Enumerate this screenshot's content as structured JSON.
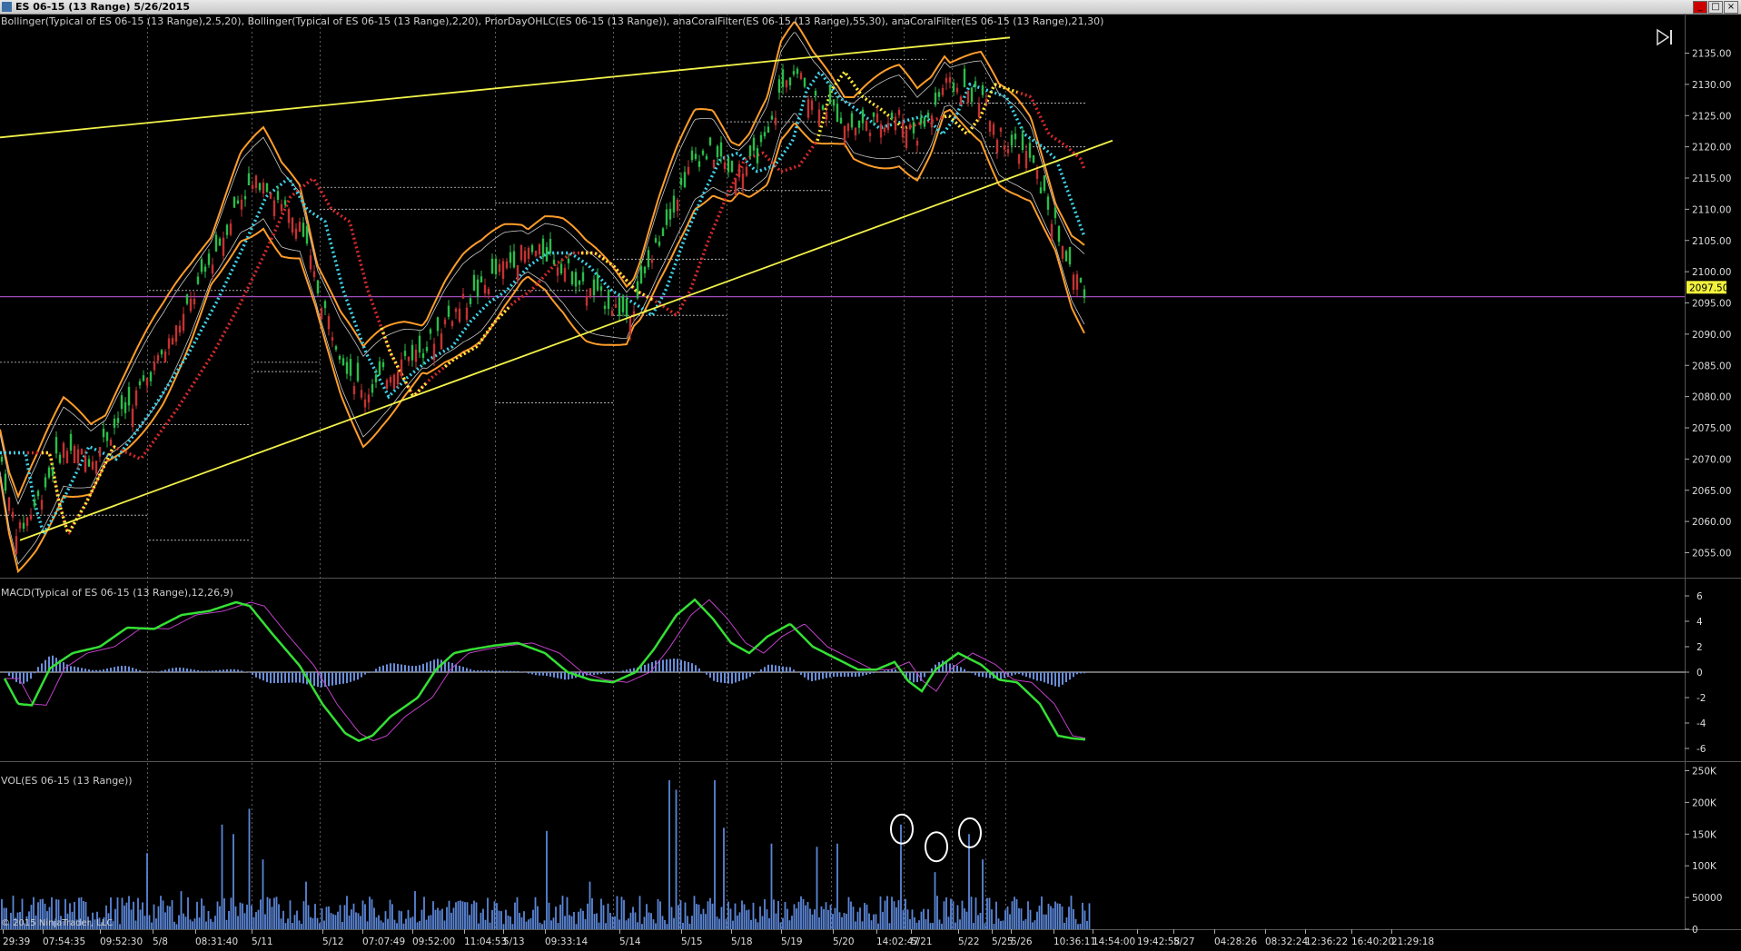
{
  "window": {
    "title": "ES 06-15 (13 Range)  5/26/2015",
    "buttons": [
      "_",
      "□",
      "×"
    ]
  },
  "copyright": "© 2015 NinjaTrader, LLC",
  "chart_data": [
    {
      "type": "candlestick",
      "title": "Bollinger(Typical of ES 06-15 (13 Range),2.5,20), Bollinger(Typical of ES 06-15 (13 Range),2,20), PriorDayOHLC(ES 06-15 (13 Range)), anaCoralFilter(ES 06-15 (13 Range),55,30), anaCoralFilter(ES 06-15 (13 Range),21,30)",
      "ylim": [
        2051,
        2139
      ],
      "yticks": [
        2055,
        2060,
        2065,
        2070,
        2075,
        2080,
        2085,
        2090,
        2095,
        2100,
        2105,
        2110,
        2115,
        2120,
        2125,
        2130,
        2135
      ],
      "last_price": "2097.50",
      "price_path": [
        [
          0,
          2071
        ],
        [
          10,
          2063
        ],
        [
          20,
          2058
        ],
        [
          40,
          2063
        ],
        [
          70,
          2072
        ],
        [
          100,
          2070
        ],
        [
          140,
          2078
        ],
        [
          180,
          2087
        ],
        [
          210,
          2095
        ],
        [
          240,
          2104
        ],
        [
          265,
          2112
        ],
        [
          290,
          2115
        ],
        [
          310,
          2110
        ],
        [
          330,
          2108
        ],
        [
          350,
          2097
        ],
        [
          375,
          2087
        ],
        [
          400,
          2080
        ],
        [
          420,
          2083
        ],
        [
          445,
          2086
        ],
        [
          470,
          2088
        ],
        [
          490,
          2092
        ],
        [
          510,
          2095
        ],
        [
          530,
          2097
        ],
        [
          555,
          2101
        ],
        [
          575,
          2103
        ],
        [
          600,
          2103
        ],
        [
          620,
          2101
        ],
        [
          645,
          2097
        ],
        [
          670,
          2095
        ],
        [
          690,
          2093
        ],
        [
          705,
          2097
        ],
        [
          725,
          2105
        ],
        [
          745,
          2112
        ],
        [
          765,
          2118
        ],
        [
          785,
          2119
        ],
        [
          805,
          2116
        ],
        [
          825,
          2117
        ],
        [
          845,
          2121
        ],
        [
          860,
          2129
        ],
        [
          875,
          2132
        ],
        [
          895,
          2128
        ],
        [
          915,
          2126
        ],
        [
          940,
          2123
        ],
        [
          965,
          2124
        ],
        [
          990,
          2125
        ],
        [
          1010,
          2122
        ],
        [
          1025,
          2125
        ],
        [
          1040,
          2130
        ],
        [
          1060,
          2129
        ],
        [
          1080,
          2128
        ],
        [
          1100,
          2122
        ],
        [
          1120,
          2120
        ],
        [
          1135,
          2118
        ],
        [
          1150,
          2112
        ],
        [
          1165,
          2106
        ],
        [
          1180,
          2100
        ],
        [
          1195,
          2097
        ]
      ],
      "prior_day_levels": [
        [
          0,
          185,
          2085.5
        ],
        [
          0,
          162,
          2075.5
        ],
        [
          0,
          162,
          2061
        ],
        [
          164,
          275,
          2097
        ],
        [
          164,
          275,
          2075.5
        ],
        [
          164,
          275,
          2057
        ],
        [
          279,
          352,
          2085.5
        ],
        [
          279,
          352,
          2084
        ],
        [
          352,
          545,
          2113.5
        ],
        [
          352,
          545,
          2110
        ],
        [
          545,
          675,
          2111
        ],
        [
          545,
          675,
          2097
        ],
        [
          545,
          675,
          2079
        ],
        [
          675,
          800,
          2102
        ],
        [
          675,
          800,
          2093
        ],
        [
          800,
          915,
          2124
        ],
        [
          800,
          915,
          2113
        ],
        [
          860,
          1000,
          2128
        ],
        [
          915,
          1020,
          2134
        ],
        [
          1000,
          1100,
          2127
        ],
        [
          1000,
          1100,
          2119
        ],
        [
          1000,
          1100,
          2115
        ],
        [
          1085,
          1195,
          2127
        ],
        [
          1085,
          1195,
          2120
        ]
      ],
      "horizontal_line": 2096,
      "trendlines": [
        [
          [
            0,
            2121.5
          ],
          [
            1112,
            2137.5
          ]
        ],
        [
          [
            22,
            2057
          ],
          [
            1225,
            2121
          ]
        ]
      ],
      "annotations": [
        "2097.50"
      ]
    },
    {
      "type": "macd",
      "title": "MACD(Typical of ES 06-15 (13 Range),12,26,9)",
      "ylim": [
        -7,
        7
      ],
      "yticks": [
        6,
        4,
        2,
        0,
        -2,
        -4,
        -6
      ],
      "macd_path": [
        [
          5,
          -0.5
        ],
        [
          20,
          -2.5
        ],
        [
          35,
          -2.6
        ],
        [
          55,
          0.3
        ],
        [
          80,
          1.5
        ],
        [
          110,
          2.0
        ],
        [
          140,
          3.5
        ],
        [
          170,
          3.4
        ],
        [
          200,
          4.5
        ],
        [
          230,
          4.8
        ],
        [
          260,
          5.5
        ],
        [
          275,
          5.2
        ],
        [
          300,
          3.0
        ],
        [
          330,
          0.5
        ],
        [
          355,
          -2.5
        ],
        [
          380,
          -4.8
        ],
        [
          395,
          -5.4
        ],
        [
          410,
          -5.0
        ],
        [
          430,
          -3.5
        ],
        [
          460,
          -2.0
        ],
        [
          480,
          0.2
        ],
        [
          500,
          1.5
        ],
        [
          520,
          1.8
        ],
        [
          545,
          2.1
        ],
        [
          570,
          2.3
        ],
        [
          600,
          1.5
        ],
        [
          625,
          0.0
        ],
        [
          650,
          -0.6
        ],
        [
          675,
          -0.8
        ],
        [
          700,
          0.0
        ],
        [
          720,
          1.8
        ],
        [
          745,
          4.5
        ],
        [
          765,
          5.7
        ],
        [
          785,
          4.2
        ],
        [
          805,
          2.3
        ],
        [
          825,
          1.5
        ],
        [
          845,
          2.8
        ],
        [
          870,
          3.8
        ],
        [
          895,
          2.0
        ],
        [
          920,
          1.1
        ],
        [
          945,
          0.2
        ],
        [
          965,
          0.2
        ],
        [
          985,
          0.8
        ],
        [
          1000,
          -0.7
        ],
        [
          1015,
          -1.5
        ],
        [
          1030,
          0.2
        ],
        [
          1055,
          1.5
        ],
        [
          1080,
          0.6
        ],
        [
          1100,
          -0.6
        ],
        [
          1120,
          -0.8
        ],
        [
          1145,
          -2.5
        ],
        [
          1165,
          -5.0
        ],
        [
          1180,
          -5.2
        ],
        [
          1195,
          -5.3
        ]
      ]
    },
    {
      "type": "bar",
      "title": "VOL(ES 06-15 (13 Range))",
      "ylim": [
        0,
        255000
      ],
      "yticks": [
        0,
        50000,
        100000,
        150000,
        200000,
        250000
      ],
      "ytick_labels": [
        "0",
        "50000",
        "100K",
        "150K",
        "200K",
        "250K"
      ],
      "spikes": [
        [
          162,
          120000
        ],
        [
          200,
          60000
        ],
        [
          245,
          165000
        ],
        [
          258,
          150000
        ],
        [
          274,
          190000
        ],
        [
          290,
          110000
        ],
        [
          337,
          75000
        ],
        [
          456,
          60000
        ],
        [
          603,
          155000
        ],
        [
          650,
          75000
        ],
        [
          737,
          235000
        ],
        [
          745,
          220000
        ],
        [
          787,
          235000
        ],
        [
          796,
          160000
        ],
        [
          850,
          135000
        ],
        [
          900,
          130000
        ],
        [
          922,
          135000
        ],
        [
          993,
          165000
        ],
        [
          1030,
          90000
        ],
        [
          1066,
          150000
        ],
        [
          1082,
          110000
        ]
      ],
      "highlight_circles": [
        [
          993,
          158000
        ],
        [
          1031,
          130000
        ],
        [
          1068,
          152000
        ]
      ]
    }
  ],
  "x_axis": {
    "labels": [
      [
        3,
        "29:39"
      ],
      [
        47,
        "07:54:35"
      ],
      [
        110,
        "09:52:30"
      ],
      [
        168,
        "5/8"
      ],
      [
        215,
        "08:31:40"
      ],
      [
        277,
        "5/11"
      ],
      [
        355,
        "5/12"
      ],
      [
        399,
        "07:07:49"
      ],
      [
        454,
        "09:52:00"
      ],
      [
        511,
        "11:04:53"
      ],
      [
        554,
        "5/13"
      ],
      [
        600,
        "09:33:14"
      ],
      [
        682,
        "5/14"
      ],
      [
        750,
        "5/15"
      ],
      [
        805,
        "5/18"
      ],
      [
        860,
        "5/19"
      ],
      [
        917,
        "5/20"
      ],
      [
        965,
        "14:02:47"
      ],
      [
        1003,
        "5/21"
      ],
      [
        1055,
        "5/22"
      ],
      [
        1092,
        "5/25"
      ],
      [
        1113,
        "5/26"
      ],
      [
        1160,
        "10:36:11"
      ],
      [
        1203,
        "14:54:00"
      ],
      [
        1252,
        "19:42:58"
      ],
      [
        1292,
        "5/27"
      ],
      [
        1337,
        "04:28:26"
      ],
      [
        1393,
        "08:32:24"
      ],
      [
        1437,
        "12:36:22"
      ],
      [
        1488,
        "16:40:20"
      ],
      [
        1532,
        "21:29:18"
      ]
    ],
    "day_separators": [
      162,
      277,
      352,
      545,
      675,
      748,
      800,
      860,
      915,
      995,
      1048,
      1085,
      1107
    ]
  },
  "colors": {
    "background": "#000000",
    "grid": "#2a2a2a",
    "outer_band": "#ff9d2a",
    "inner_band": "#c8c8c8",
    "coral_55": "#d42a2a",
    "coral_21": "#3fd0e8",
    "coral_yellow": "#f2f23c",
    "trendline": "#f2f24a",
    "macd_line": "#35e035",
    "signal_line": "#c040c8",
    "histogram": "#6a8ed8",
    "volume_bar": "#5b86d8",
    "prior_day": "#b0b0b0",
    "horizontal_line": "#a04ab8",
    "up_candle": "#2bbd4a",
    "down_candle": "#c43232"
  }
}
